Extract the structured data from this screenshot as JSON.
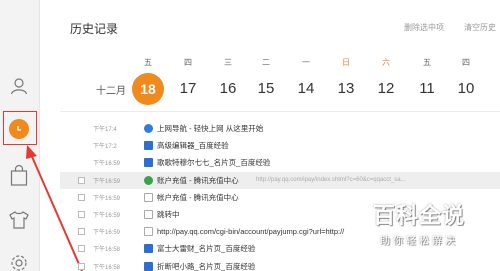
{
  "header": {
    "title": "历史记录",
    "link_delete": "删除选中项",
    "link_clear": "清空历史"
  },
  "calendar": {
    "month": "十二月",
    "days": [
      {
        "weekday": "五",
        "date": "18",
        "active": true,
        "weekend": false
      },
      {
        "weekday": "四",
        "date": "17",
        "active": false,
        "weekend": false
      },
      {
        "weekday": "三",
        "date": "16",
        "active": false,
        "weekend": false
      },
      {
        "weekday": "二",
        "date": "15",
        "active": false,
        "weekend": false
      },
      {
        "weekday": "一",
        "date": "14",
        "active": false,
        "weekend": false
      },
      {
        "weekday": "日",
        "date": "13",
        "active": false,
        "weekend": true
      },
      {
        "weekday": "六",
        "date": "12",
        "active": false,
        "weekend": true
      },
      {
        "weekday": "五",
        "date": "11",
        "active": false,
        "weekend": false
      },
      {
        "weekday": "四",
        "date": "10",
        "active": false,
        "weekend": false
      }
    ]
  },
  "history": [
    {
      "time": "下午17:4",
      "name": "上网导航 - 轻快上网 从这里开始",
      "url": "",
      "icon": "globe-icon",
      "checkbox": false,
      "selected": false
    },
    {
      "time": "下午17:2",
      "name": "高级编辑器_百度经验",
      "url": "",
      "icon": "baidu-paw-icon",
      "checkbox": false,
      "selected": false
    },
    {
      "time": "下午16:59",
      "name": "歌歌特穆尔七七_名片页_百度经验",
      "url": "",
      "icon": "baidu-paw-icon",
      "checkbox": false,
      "selected": false
    },
    {
      "time": "下午16:59",
      "name": "账户充值 - 腾讯充值中心",
      "url": "http://pay.qq.com/ipay/index.shtml?c=60&c=qqacct_sa...",
      "icon": "tencent-icon",
      "checkbox": true,
      "selected": true
    },
    {
      "time": "下午16:59",
      "name": "帐户充值 - 腾讯充值中心",
      "url": "",
      "icon": "page-icon",
      "checkbox": true,
      "selected": false
    },
    {
      "time": "下午16:59",
      "name": "跳转中",
      "url": "",
      "icon": "page-icon",
      "checkbox": true,
      "selected": false
    },
    {
      "time": "下午16:59",
      "name": "http://pay.qq.com/cgi-bin/account/payjump.cgi?url=http://",
      "url": "",
      "icon": "page-icon",
      "checkbox": true,
      "selected": false
    },
    {
      "time": "下午16:58",
      "name": "富士大雷财_名片页_百度经验",
      "url": "",
      "icon": "baidu-paw-icon",
      "checkbox": true,
      "selected": false
    },
    {
      "time": "下午16:58",
      "name": "折断吧小路_名片页_百度经验",
      "url": "",
      "icon": "baidu-paw-icon",
      "checkbox": true,
      "selected": false
    }
  ],
  "sidebar": {
    "items": [
      "user-icon",
      "clock-icon",
      "shopping-bag-icon",
      "shirt-icon",
      "gear-icon"
    ]
  },
  "watermark": {
    "title": "百科全说",
    "subtitle": "助你轻松解决"
  },
  "colors": {
    "accent": "#f08a1c",
    "highlight": "#e53935",
    "weekend": "#e8843a"
  }
}
